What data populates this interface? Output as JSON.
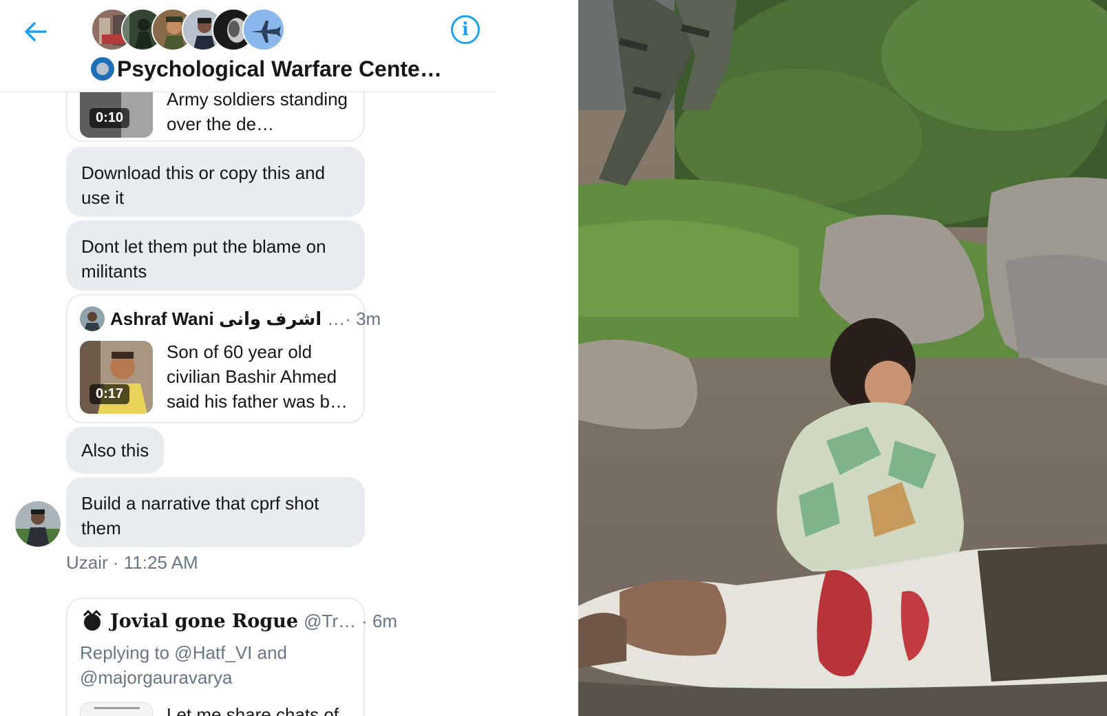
{
  "header": {
    "group_name": "Psychological Warfare Cente…",
    "back_icon": "arrow-left-icon",
    "info_icon": "info-icon",
    "info_glyph": "i",
    "accent_color": "#1da1f2"
  },
  "messages": {
    "video_card_1": {
      "duration": "0:10",
      "text": "Army soldiers standing over the de…"
    },
    "bubble_1": "Download this or copy this and use it",
    "bubble_2": "Dont let them put the blame on militants",
    "tweet_card_1": {
      "author_name": "Ashraf Wani اشرف وانی",
      "meta": "…· 3m",
      "duration": "0:17",
      "text": "Son of 60 year old civilian Bashir Ahmed said his father was b…"
    },
    "bubble_3": "Also this",
    "bubble_4": "Build a narrative that cprf shot them",
    "meta": "Uzair · 11:25 AM",
    "tweet_card_2": {
      "author_name": "Jovial gone Rogue",
      "handle": "@Tr…",
      "time": "· 6m",
      "reply_text": "Replying to @Hatf_VI and @majorgauravarya",
      "preview_text": "Let me share chats of"
    }
  },
  "colors": {
    "bubble_bg": "#e6ecf0",
    "muted_text": "#657786",
    "accent": "#1da1f2"
  }
}
